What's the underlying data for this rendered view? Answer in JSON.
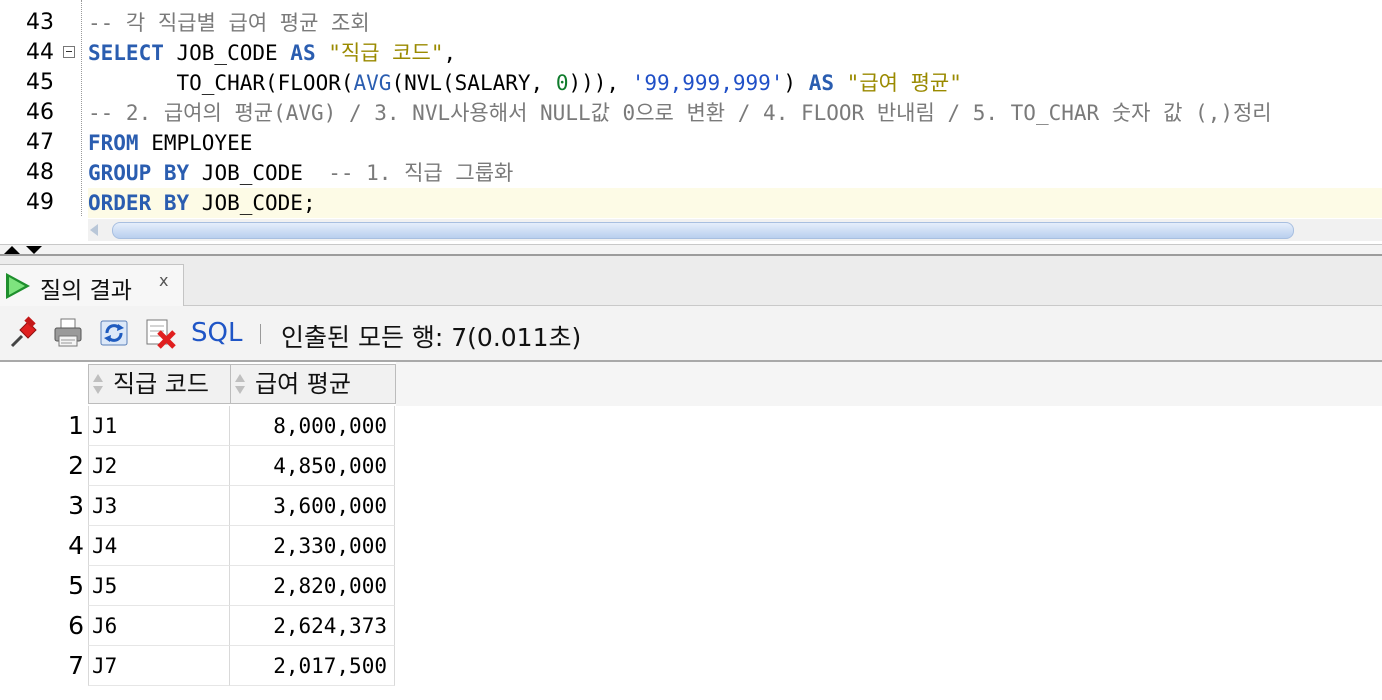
{
  "editor": {
    "line_numbers": [
      "43",
      "44",
      "45",
      "46",
      "47",
      "48",
      "49"
    ],
    "lines": [
      [
        {
          "t": "-- 각 직급별 급여 평균 조회",
          "c": "cmt"
        }
      ],
      [
        {
          "t": "SELECT",
          "c": "kw"
        },
        {
          "t": " JOB_CODE "
        },
        {
          "t": "AS",
          "c": "kw"
        },
        {
          "t": " "
        },
        {
          "t": "\"직급 코드\"",
          "c": "str"
        },
        {
          "t": ","
        }
      ],
      [
        {
          "t": "       TO_CHAR(FLOOR("
        },
        {
          "t": "AVG",
          "c": "fn"
        },
        {
          "t": "(NVL(SALARY, "
        },
        {
          "t": "0",
          "c": "num"
        },
        {
          "t": "))), "
        },
        {
          "t": "'99,999,999'",
          "c": "strq"
        },
        {
          "t": ") "
        },
        {
          "t": "AS",
          "c": "kw"
        },
        {
          "t": " "
        },
        {
          "t": "\"급여 평균\"",
          "c": "str"
        }
      ],
      [
        {
          "t": "-- 2. 급여의 평균(AVG) / 3. NVL사용해서 NULL값 0으로 변환 / 4. FLOOR 반내림 / 5. TO_CHAR 숫자 값 (,)정리",
          "c": "cmt"
        }
      ],
      [
        {
          "t": "FROM",
          "c": "kw"
        },
        {
          "t": " EMPLOYEE"
        }
      ],
      [
        {
          "t": "GROUP BY",
          "c": "kw"
        },
        {
          "t": " JOB_CODE  "
        },
        {
          "t": "-- 1. 직급 그룹화",
          "c": "cmt"
        }
      ],
      [
        {
          "t": "ORDER BY",
          "c": "kw"
        },
        {
          "t": " JOB_CODE;"
        }
      ]
    ],
    "current_line_index": 6
  },
  "results": {
    "tab_label": "질의 결과",
    "tab_close": "x",
    "toolbar": {
      "icons": [
        "pin-icon",
        "print-icon",
        "refresh-icon",
        "delete-icon"
      ],
      "sql_label": "SQL",
      "status": "인출된 모든 행: 7(0.011초)"
    },
    "columns": [
      "직급 코드",
      "급여 평균"
    ],
    "rows": [
      {
        "n": "1",
        "job": "J1",
        "avg": "8,000,000"
      },
      {
        "n": "2",
        "job": "J2",
        "avg": "4,850,000"
      },
      {
        "n": "3",
        "job": "J3",
        "avg": "3,600,000"
      },
      {
        "n": "4",
        "job": "J4",
        "avg": "2,330,000"
      },
      {
        "n": "5",
        "job": "J5",
        "avg": "2,820,000"
      },
      {
        "n": "6",
        "job": "J6",
        "avg": "2,624,373"
      },
      {
        "n": "7",
        "job": "J7",
        "avg": "2,017,500"
      }
    ]
  },
  "colors": {
    "keyword": "#2a5db0",
    "string": "#9a8a00",
    "number": "#0f7b2c",
    "comment": "#7a7a7a",
    "current_line": "#fdfbe6"
  }
}
